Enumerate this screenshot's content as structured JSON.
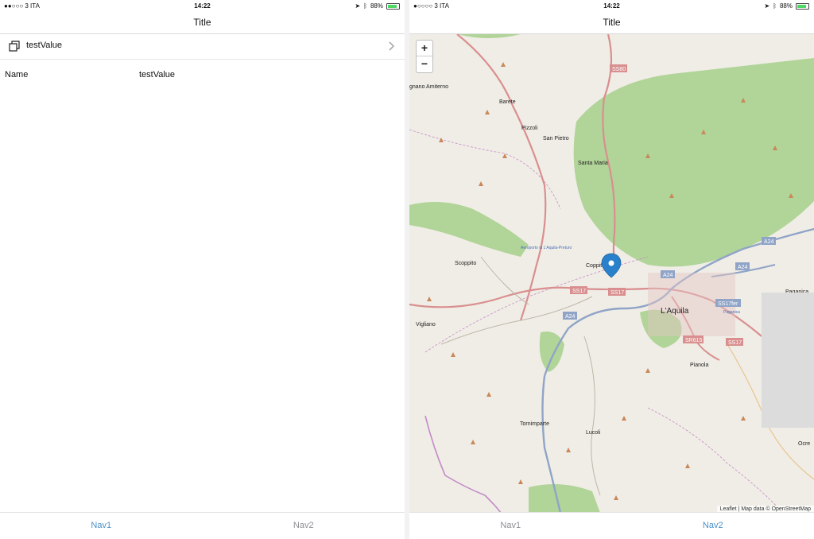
{
  "status_left": {
    "carrier": "●●○○○ 3 ITA",
    "time": "14:22",
    "battery": "88%",
    "battery_level": 0.88
  },
  "status_right": {
    "carrier": "●○○○○ 3 ITA",
    "time": "14:22",
    "battery": "88%",
    "battery_level": 0.88
  },
  "left_screen": {
    "title": "Title",
    "row_label": "testValue",
    "field_label": "Name",
    "field_value": "testValue",
    "tabs": [
      {
        "label": "Nav1",
        "active": true
      },
      {
        "label": "Nav2",
        "active": false
      }
    ]
  },
  "right_screen": {
    "title": "Title",
    "zoom_in": "+",
    "zoom_out": "−",
    "attribution": "Leaflet | Map data © OpenStreetMap",
    "places": [
      "gnano Amiterno",
      "Barete",
      "Pizzoli",
      "San Pietro",
      "Santa Maria",
      "Coppito",
      "Scoppito",
      "Vigliano",
      "L'Aquila",
      "Pianola",
      "Tornimparte",
      "Lucoli",
      "Paganica",
      "Ocre",
      "Aeroporto di L'Aquila-Preturo",
      "Paganica"
    ],
    "roads": [
      "SS80",
      "A24",
      "A24",
      "A24",
      "SS17",
      "SS17",
      "A24",
      "SS17fer",
      "SR615",
      "SS17"
    ],
    "tabs": [
      {
        "label": "Nav1",
        "active": false
      },
      {
        "label": "Nav2",
        "active": true
      }
    ]
  },
  "colors": {
    "accent": "#4a90c9",
    "inactive_tab": "#8e8e93",
    "map_land": "#f0ede6",
    "map_forest": "#a6cf8a",
    "road_major": "#d98f8f",
    "motorway": "#8fa4c7",
    "boundary": "#c48bc8",
    "marker": "#2a81cb"
  },
  "icons": {
    "row_icon": "copy-icon",
    "chevron": "chevron-right-icon",
    "marker": "map-marker-icon"
  }
}
